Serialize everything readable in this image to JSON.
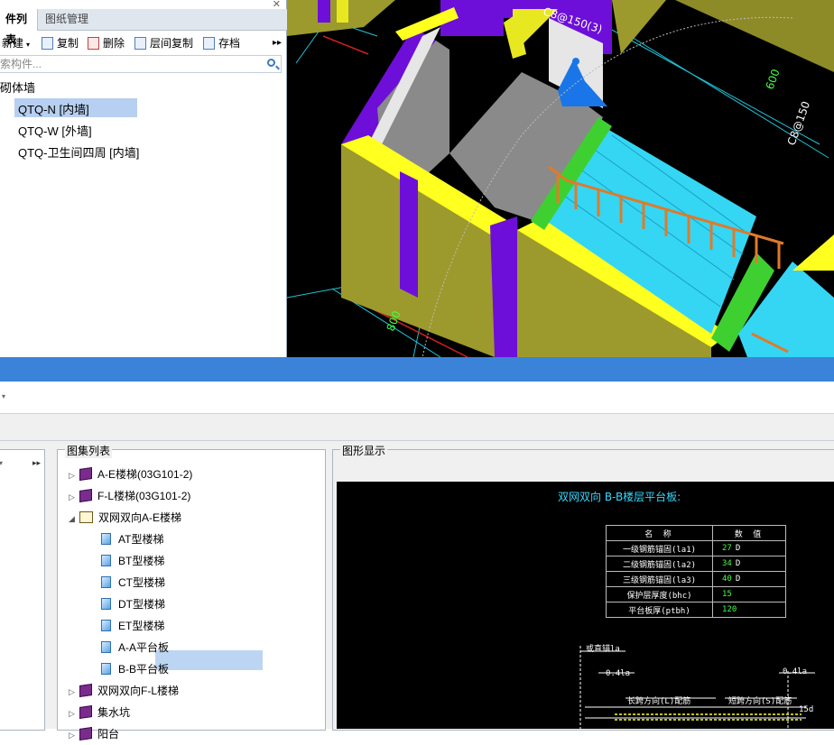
{
  "component_panel": {
    "tabs": [
      "件列表",
      "图纸管理"
    ],
    "toolbar": {
      "new_label": "新建",
      "copy_label": "复制",
      "delete_label": "删除",
      "floor_copy_label": "层间复制",
      "save_label": "存档"
    },
    "search_placeholder": "索构件...",
    "tree": {
      "category": "砌体墙",
      "items": [
        "QTQ-N [内墙]",
        "QTQ-W [外墙]",
        "QTQ-卫生间四周 [内墙]"
      ],
      "selected_index": 0
    }
  },
  "viewport": {
    "labels": [
      "C8@150(3)",
      "600",
      "C8@150",
      "800"
    ]
  },
  "atlas_panel": {
    "title": "图集列表",
    "items": [
      {
        "label": "A-E楼梯(03G101-2)",
        "kind": "book",
        "level": 0,
        "expanded": false
      },
      {
        "label": "F-L楼梯(03G101-2)",
        "kind": "book",
        "level": 0,
        "expanded": false
      },
      {
        "label": "双网双向A-E楼梯",
        "kind": "book-open",
        "level": 0,
        "expanded": true
      },
      {
        "label": "AT型楼梯",
        "kind": "doc",
        "level": 1
      },
      {
        "label": "BT型楼梯",
        "kind": "doc",
        "level": 1
      },
      {
        "label": "CT型楼梯",
        "kind": "doc",
        "level": 1
      },
      {
        "label": "DT型楼梯",
        "kind": "doc",
        "level": 1
      },
      {
        "label": "ET型楼梯",
        "kind": "doc",
        "level": 1
      },
      {
        "label": "A-A平台板",
        "kind": "doc",
        "level": 1
      },
      {
        "label": "B-B平台板",
        "kind": "doc",
        "level": 1,
        "selected": true
      },
      {
        "label": "双网双向F-L楼梯",
        "kind": "book",
        "level": 0,
        "expanded": false
      },
      {
        "label": "集水坑",
        "kind": "book",
        "level": 0,
        "expanded": false
      },
      {
        "label": "阳台",
        "kind": "book",
        "level": 0,
        "expanded": false
      }
    ]
  },
  "graphic_panel": {
    "title": "图形显示",
    "drawing_title": "双网双向 B-B楼层平台板:",
    "table": {
      "headers": [
        "名 称",
        "数 值"
      ],
      "rows": [
        {
          "name": "一级钢筋锚固(la1)",
          "value": "27",
          "unit": "D"
        },
        {
          "name": "二级钢筋锚固(la2)",
          "value": "34",
          "unit": "D"
        },
        {
          "name": "三级钢筋锚固(la3)",
          "value": "40",
          "unit": "D"
        },
        {
          "name": "保护层厚度(bhc)",
          "value": "15",
          "unit": ""
        },
        {
          "name": "平台板厚(ptbh)",
          "value": "120",
          "unit": ""
        }
      ]
    },
    "annotations": {
      "anchor_label": "或直锚la",
      "left_ratio": "0.4la",
      "right_ratio": "0.4la",
      "long_span": "长跨方向(L)配筋",
      "short_span": "短跨方向(S)配筋",
      "dim": "15d"
    }
  },
  "colors": {
    "accent_blue": "#3b83d8",
    "wall_yellow": "#9c9a2c",
    "wall_purple": "#6d0fd8",
    "stair_cyan": "#34d6f4",
    "rail_orange": "#e07a2a",
    "cad_green": "#41ff41",
    "cad_cyan": "#38d9ff"
  }
}
